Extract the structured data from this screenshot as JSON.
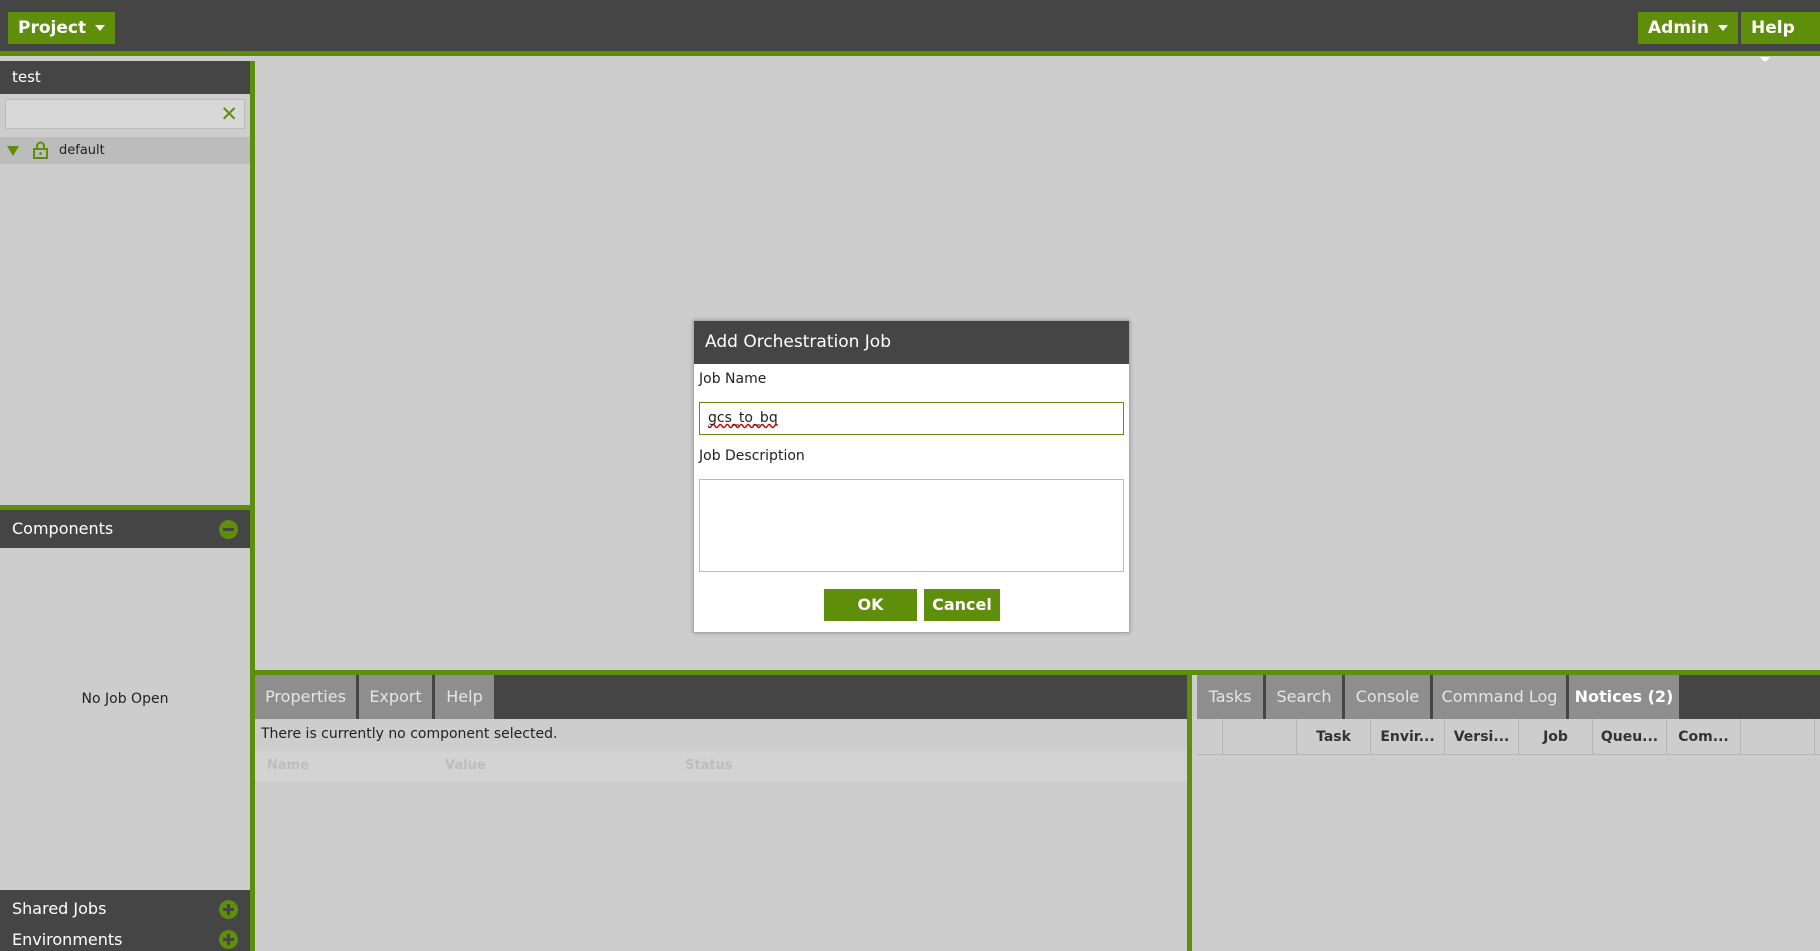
{
  "topbar": {
    "project_menu": "Project",
    "admin_menu": "Admin",
    "help_menu": "Help"
  },
  "sidebar": {
    "project_name": "test",
    "search_value": "",
    "tree": [
      {
        "label": "default",
        "icon": "lock-icon",
        "expanded": true
      }
    ],
    "components_title": "Components",
    "components_empty": "No Job Open",
    "shared_jobs_title": "Shared Jobs",
    "environments_title": "Environments"
  },
  "properties_panel": {
    "tabs": [
      "Properties",
      "Export",
      "Help"
    ],
    "empty_message": "There is currently no component selected.",
    "columns": [
      "Name",
      "Value",
      "Status"
    ]
  },
  "tasks_panel": {
    "tabs": [
      "Tasks",
      "Search",
      "Console",
      "Command Log",
      "Notices (2)"
    ],
    "active_tab": "Notices (2)",
    "columns": [
      "",
      "",
      "Task",
      "Envir...",
      "Versi...",
      "Job",
      "Queu...",
      "Com...",
      ""
    ]
  },
  "dialog": {
    "title": "Add Orchestration Job",
    "job_name_label": "Job Name",
    "job_name_value": "gcs_to_bq",
    "job_description_label": "Job Description",
    "job_description_value": "",
    "ok_label": "OK",
    "cancel_label": "Cancel"
  },
  "colors": {
    "accent": "#5f8e0a",
    "header": "#454545",
    "background": "#cdcdcd"
  }
}
